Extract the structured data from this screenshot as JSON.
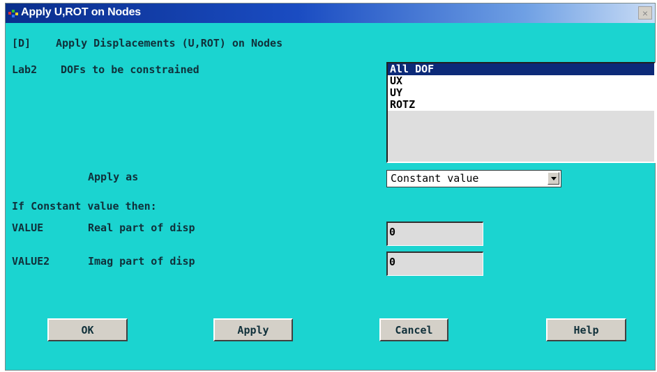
{
  "window": {
    "title": "Apply U,ROT on Nodes",
    "close_glyph": "×"
  },
  "header": {
    "tag": "[D]",
    "text": "Apply Displacements (U,ROT) on Nodes"
  },
  "lab2": {
    "key": "Lab2",
    "label": "DOFs to be constrained",
    "options": [
      "All DOF",
      "UX",
      "UY",
      "ROTZ"
    ],
    "selected": "All DOF"
  },
  "apply_as": {
    "label": "Apply as",
    "value": "Constant value"
  },
  "constant_heading": "If Constant value then:",
  "value1": {
    "key": "VALUE",
    "label": "Real part of disp",
    "value": "0"
  },
  "value2": {
    "key": "VALUE2",
    "label": "Imag part of disp",
    "value": "0"
  },
  "buttons": {
    "ok": "OK",
    "apply": "Apply",
    "cancel": "Cancel",
    "help": "Help"
  },
  "colors": {
    "dialog_bg": "#1bd4d0",
    "title_bar": "#0a2e8c",
    "selection": "#0c2a78"
  }
}
